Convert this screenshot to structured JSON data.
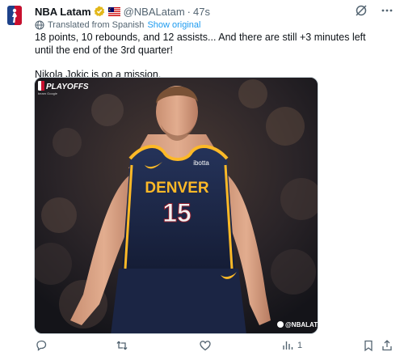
{
  "author": {
    "name": "NBA Latam",
    "handle": "@NBALatam",
    "separator": "·",
    "time": "47s",
    "avatar_icon": "nba-logo-icon",
    "verified_icon": "gold-verified-badge-icon",
    "flag_icon": "malaysia-flag-icon"
  },
  "translation": {
    "note": "Translated from Spanish",
    "show_original": "Show original"
  },
  "text": {
    "line1": "18 points, 10 rebounds, and 12 assists... And there are still +3 minutes left",
    "line2": "until the end of the 3rd quarter!",
    "line3": "Nikola Jokic is on a mission."
  },
  "media": {
    "badge_title": "PLAYOFFS",
    "badge_sub": "beam Google",
    "jersey_team": "DENVER",
    "jersey_number": "15",
    "jersey_sponsor": "ibotta",
    "watermark": "@NBALATAM"
  },
  "stats": {
    "views": "1"
  },
  "colors": {
    "text": "#0f1419",
    "secondary": "#536471",
    "link": "#1d9bf0",
    "jersey_navy": "#1d2a48",
    "jersey_gold": "#fdb927"
  }
}
